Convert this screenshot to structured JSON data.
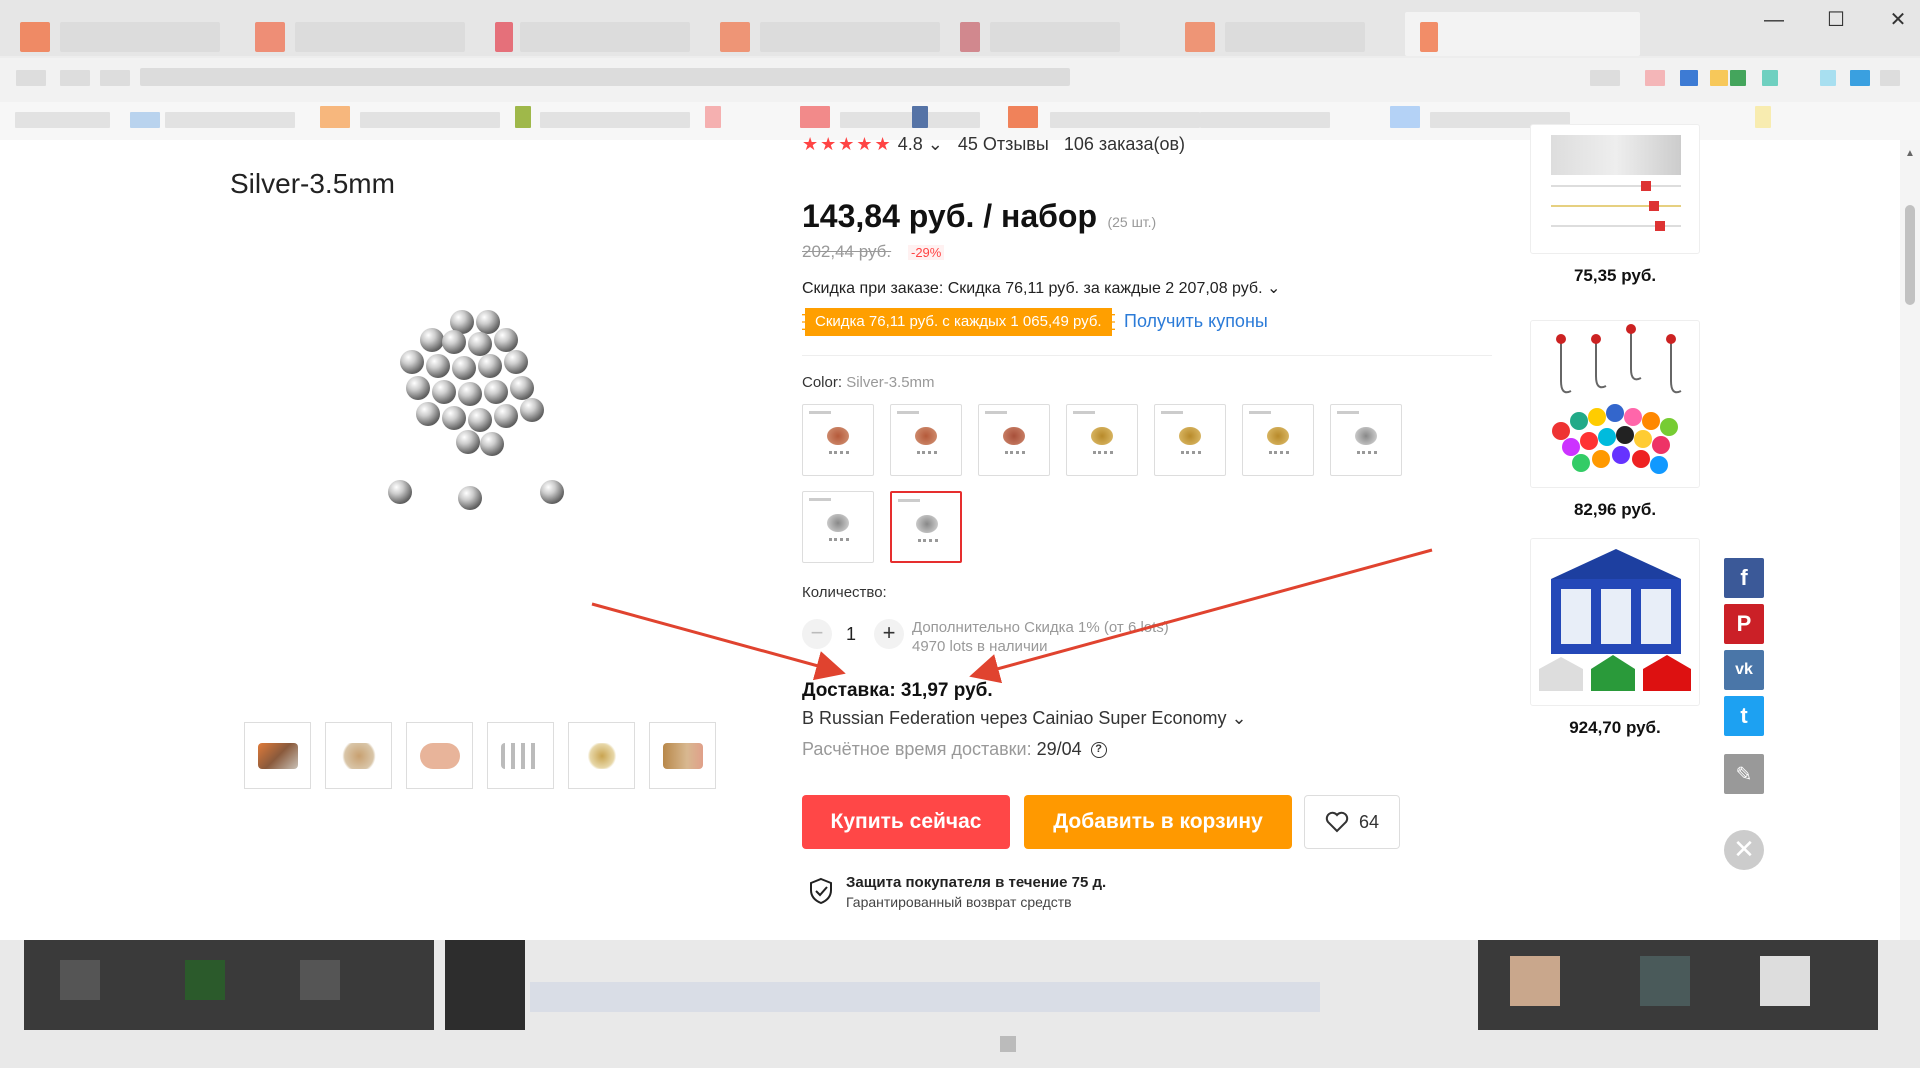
{
  "window": {
    "minimize": "—",
    "maximize": "☐",
    "close": "✕"
  },
  "product": {
    "variant_title": "Silver-3.5mm",
    "rating": {
      "stars": "★★★★★",
      "score": "4.8 ⌄",
      "reviews": "45 Отзывы",
      "orders": "106 заказа(ов)"
    },
    "price": "143,84 руб. / набор",
    "price_unit": "(25 шт.)",
    "old_price": "202,44 руб.",
    "discount": "-29%",
    "order_discount": "Скидка при заказе: Скидка 76,11 руб. за каждые 2 207,08 руб. ⌄",
    "coupon": "Скидка 76,11 руб. с каждых 1 065,49 руб.",
    "coupon_link": "Получить купоны",
    "color_label": "Color:",
    "color_value": "Silver-3.5mm",
    "quantity_label": "Количество:",
    "quantity": "1",
    "qty_minus": "−",
    "qty_plus": "+",
    "qty_extra_line1": "Дополнительно Скидка 1% (от 6 lots)",
    "qty_extra_line2": "4970 lots в наличии",
    "shipping_price": "Доставка: 31,97 руб.",
    "shipping_route": "В Russian Federation через Cainiao Super Economy ⌄",
    "shipping_time_label": "Расчётное время доставки:",
    "shipping_time_value": "29/04",
    "help_icon": "?",
    "buy_now": "Купить сейчас",
    "add_to_cart": "Добавить в корзину",
    "wishlist_count": "64",
    "protection_title": "Защита покупателя в течение 75 д.",
    "protection_sub": "Гарантированный возврат средств"
  },
  "recommendations": [
    {
      "price": "75,35 руб."
    },
    {
      "price": "82,96 руб."
    },
    {
      "price": "924,70 руб."
    }
  ],
  "social": {
    "facebook": "f",
    "pinterest": "P",
    "vk": "vk",
    "twitter": "t",
    "edit": "✎",
    "close": "✕"
  },
  "colors": {
    "buy": "#ff4747",
    "cart": "#ff9900",
    "coupon": "#ff9f00",
    "link": "#2b7bd8",
    "selected": "#e62e2e",
    "arrow": "#e0432f"
  }
}
